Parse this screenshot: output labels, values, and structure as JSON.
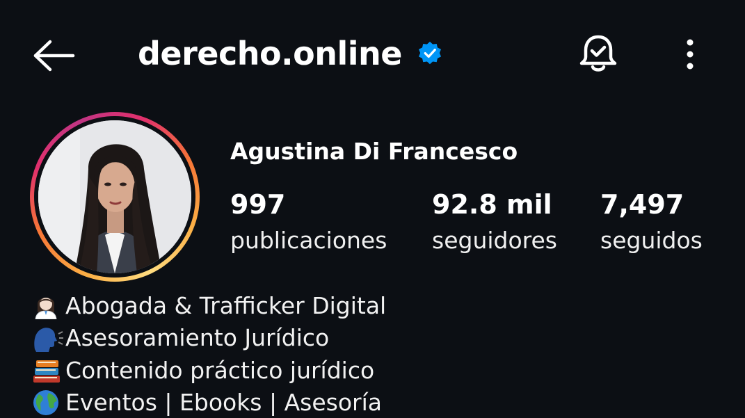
{
  "header": {
    "username": "derecho.online",
    "verified": true,
    "icons": {
      "back": "back-arrow-icon",
      "verified": "verified-badge-icon",
      "notifications": "bell-check-icon",
      "more": "more-vertical-icon"
    }
  },
  "profile": {
    "full_name": "Agustina Di Francesco",
    "avatar": "profile-photo",
    "stats": [
      {
        "value": "997",
        "label": "publicaciones"
      },
      {
        "value": "92.8 mil",
        "label": "seguidores"
      },
      {
        "value": "7,497",
        "label": "seguidos"
      }
    ]
  },
  "bio": [
    {
      "icon": "woman-office-worker-emoji",
      "text": "Abogada & Trafficker Digital"
    },
    {
      "icon": "speaking-head-emoji",
      "text": "Asesoramiento Jurídico"
    },
    {
      "icon": "books-emoji",
      "text": "Contenido práctico jurídico"
    },
    {
      "icon": "globe-emoji",
      "text": "Eventos | Ebooks | Asesoría"
    }
  ],
  "colors": {
    "background": "#0c0f14",
    "text": "#ffffff",
    "verified": "#0095f6"
  }
}
